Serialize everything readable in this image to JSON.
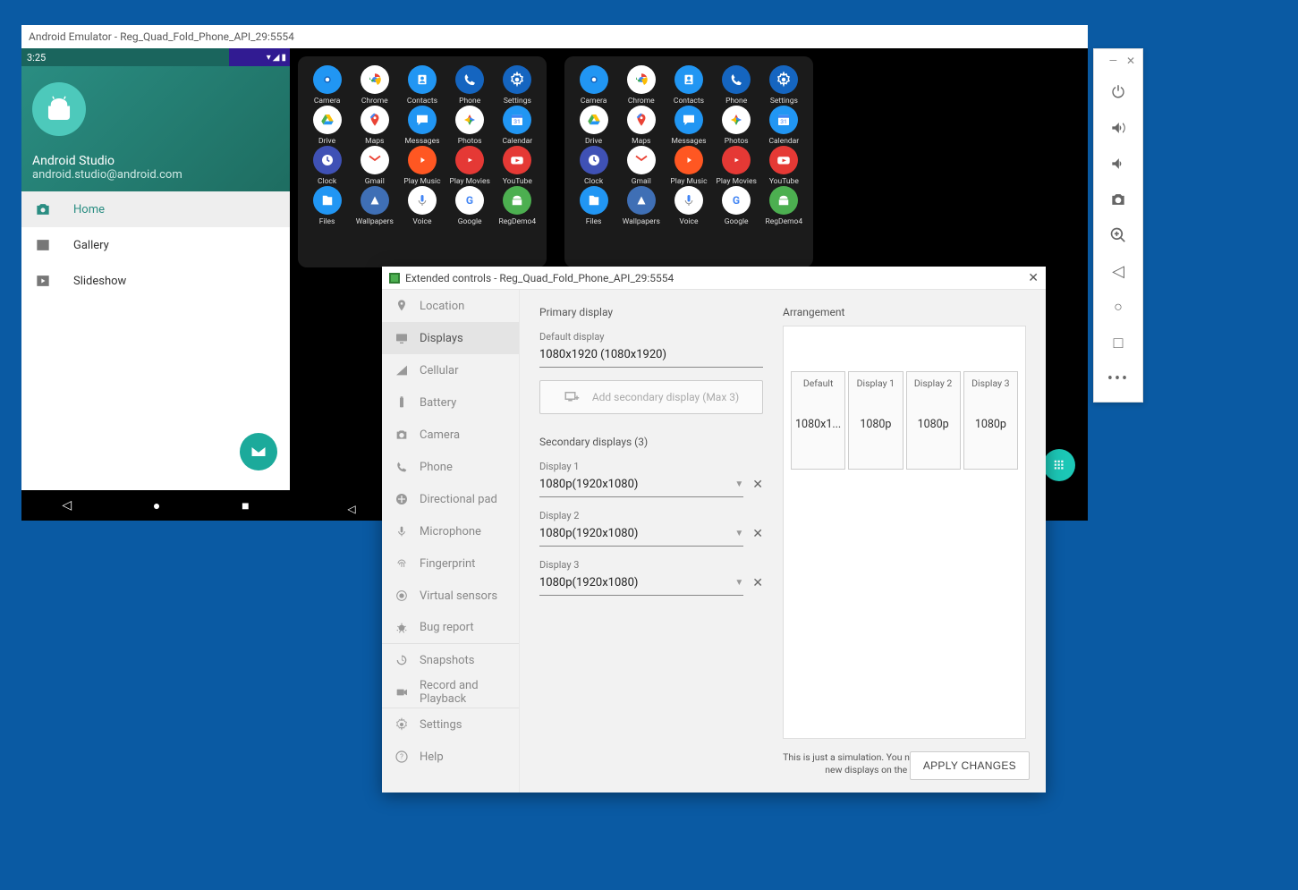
{
  "emulator_title": "Android Emulator - Reg_Quad_Fold_Phone_API_29:5554",
  "phone1": {
    "time": "3:25",
    "name": "Android Studio",
    "email": "android.studio@android.com",
    "drawer": [
      {
        "label": "Home",
        "active": true
      },
      {
        "label": "Gallery",
        "active": false
      },
      {
        "label": "Slideshow",
        "active": false
      }
    ]
  },
  "launcher_apps": [
    [
      "Camera",
      "Chrome",
      "Contacts",
      "Phone",
      "Settings"
    ],
    [
      "Drive",
      "Maps",
      "Messages",
      "Photos",
      "Calendar"
    ],
    [
      "Clock",
      "Gmail",
      "Play Music",
      "Play Movies",
      "YouTube"
    ],
    [
      "Files",
      "Wallpapers",
      "Voice",
      "Google",
      "RegDemo4"
    ]
  ],
  "excontrols": {
    "title": "Extended controls - Reg_Quad_Fold_Phone_API_29:5554",
    "sidebar": [
      "Location",
      "Displays",
      "Cellular",
      "Battery",
      "Camera",
      "Phone",
      "Directional pad",
      "Microphone",
      "Fingerprint",
      "Virtual sensors",
      "Bug report",
      "Snapshots",
      "Record and Playback",
      "Settings",
      "Help"
    ],
    "active_tab": "Displays",
    "primary_label": "Primary display",
    "default_display_label": "Default display",
    "default_display_value": "1080x1920 (1080x1920)",
    "add_secondary_label": "Add secondary display (Max 3)",
    "secondary_header": "Secondary displays (3)",
    "secondaries": [
      {
        "label": "Display 1",
        "value": "1080p(1920x1080)"
      },
      {
        "label": "Display 2",
        "value": "1080p(1920x1080)"
      },
      {
        "label": "Display 3",
        "value": "1080p(1920x1080)"
      }
    ],
    "arrangement_label": "Arrangement",
    "arrangement": [
      {
        "title": "Default",
        "res": "1080x1..."
      },
      {
        "title": "Display 1",
        "res": "1080p"
      },
      {
        "title": "Display 2",
        "res": "1080p"
      },
      {
        "title": "Display 3",
        "res": "1080p"
      }
    ],
    "sim_note": "This is just a simulation. You need to apply changes to see new displays on the Emulator window.",
    "apply_label": "APPLY CHANGES"
  },
  "toolbar": [
    "power",
    "volume-up",
    "volume-down",
    "screenshot",
    "zoom",
    "back",
    "home-circle",
    "overview",
    "more"
  ],
  "app_colors": {
    "Camera": "#2196f3",
    "Chrome": "#ffffff",
    "Contacts": "#2196f3",
    "Phone": "#1565c0",
    "Settings": "#1565c0",
    "Drive": "#ffffff",
    "Maps": "#ffffff",
    "Messages": "#2196f3",
    "Photos": "#ffffff",
    "Calendar": "#2196f3",
    "Clock": "#3f51b5",
    "Gmail": "#ffffff",
    "Play Music": "#ff5722",
    "Play Movies": "#e53935",
    "YouTube": "#e53935",
    "Files": "#2196f3",
    "Wallpapers": "#3f6fb5",
    "Voice": "#ffffff",
    "Google": "#ffffff",
    "RegDemo4": "#4caf50"
  }
}
